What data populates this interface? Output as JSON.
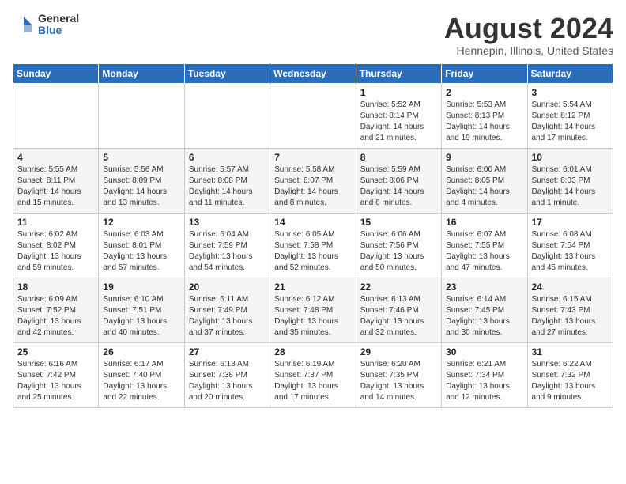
{
  "header": {
    "logo_general": "General",
    "logo_blue": "Blue",
    "month": "August 2024",
    "location": "Hennepin, Illinois, United States"
  },
  "weekdays": [
    "Sunday",
    "Monday",
    "Tuesday",
    "Wednesday",
    "Thursday",
    "Friday",
    "Saturday"
  ],
  "weeks": [
    [
      {
        "day": "",
        "info": ""
      },
      {
        "day": "",
        "info": ""
      },
      {
        "day": "",
        "info": ""
      },
      {
        "day": "",
        "info": ""
      },
      {
        "day": "1",
        "info": "Sunrise: 5:52 AM\nSunset: 8:14 PM\nDaylight: 14 hours\nand 21 minutes."
      },
      {
        "day": "2",
        "info": "Sunrise: 5:53 AM\nSunset: 8:13 PM\nDaylight: 14 hours\nand 19 minutes."
      },
      {
        "day": "3",
        "info": "Sunrise: 5:54 AM\nSunset: 8:12 PM\nDaylight: 14 hours\nand 17 minutes."
      }
    ],
    [
      {
        "day": "4",
        "info": "Sunrise: 5:55 AM\nSunset: 8:11 PM\nDaylight: 14 hours\nand 15 minutes."
      },
      {
        "day": "5",
        "info": "Sunrise: 5:56 AM\nSunset: 8:09 PM\nDaylight: 14 hours\nand 13 minutes."
      },
      {
        "day": "6",
        "info": "Sunrise: 5:57 AM\nSunset: 8:08 PM\nDaylight: 14 hours\nand 11 minutes."
      },
      {
        "day": "7",
        "info": "Sunrise: 5:58 AM\nSunset: 8:07 PM\nDaylight: 14 hours\nand 8 minutes."
      },
      {
        "day": "8",
        "info": "Sunrise: 5:59 AM\nSunset: 8:06 PM\nDaylight: 14 hours\nand 6 minutes."
      },
      {
        "day": "9",
        "info": "Sunrise: 6:00 AM\nSunset: 8:05 PM\nDaylight: 14 hours\nand 4 minutes."
      },
      {
        "day": "10",
        "info": "Sunrise: 6:01 AM\nSunset: 8:03 PM\nDaylight: 14 hours\nand 1 minute."
      }
    ],
    [
      {
        "day": "11",
        "info": "Sunrise: 6:02 AM\nSunset: 8:02 PM\nDaylight: 13 hours\nand 59 minutes."
      },
      {
        "day": "12",
        "info": "Sunrise: 6:03 AM\nSunset: 8:01 PM\nDaylight: 13 hours\nand 57 minutes."
      },
      {
        "day": "13",
        "info": "Sunrise: 6:04 AM\nSunset: 7:59 PM\nDaylight: 13 hours\nand 54 minutes."
      },
      {
        "day": "14",
        "info": "Sunrise: 6:05 AM\nSunset: 7:58 PM\nDaylight: 13 hours\nand 52 minutes."
      },
      {
        "day": "15",
        "info": "Sunrise: 6:06 AM\nSunset: 7:56 PM\nDaylight: 13 hours\nand 50 minutes."
      },
      {
        "day": "16",
        "info": "Sunrise: 6:07 AM\nSunset: 7:55 PM\nDaylight: 13 hours\nand 47 minutes."
      },
      {
        "day": "17",
        "info": "Sunrise: 6:08 AM\nSunset: 7:54 PM\nDaylight: 13 hours\nand 45 minutes."
      }
    ],
    [
      {
        "day": "18",
        "info": "Sunrise: 6:09 AM\nSunset: 7:52 PM\nDaylight: 13 hours\nand 42 minutes."
      },
      {
        "day": "19",
        "info": "Sunrise: 6:10 AM\nSunset: 7:51 PM\nDaylight: 13 hours\nand 40 minutes."
      },
      {
        "day": "20",
        "info": "Sunrise: 6:11 AM\nSunset: 7:49 PM\nDaylight: 13 hours\nand 37 minutes."
      },
      {
        "day": "21",
        "info": "Sunrise: 6:12 AM\nSunset: 7:48 PM\nDaylight: 13 hours\nand 35 minutes."
      },
      {
        "day": "22",
        "info": "Sunrise: 6:13 AM\nSunset: 7:46 PM\nDaylight: 13 hours\nand 32 minutes."
      },
      {
        "day": "23",
        "info": "Sunrise: 6:14 AM\nSunset: 7:45 PM\nDaylight: 13 hours\nand 30 minutes."
      },
      {
        "day": "24",
        "info": "Sunrise: 6:15 AM\nSunset: 7:43 PM\nDaylight: 13 hours\nand 27 minutes."
      }
    ],
    [
      {
        "day": "25",
        "info": "Sunrise: 6:16 AM\nSunset: 7:42 PM\nDaylight: 13 hours\nand 25 minutes."
      },
      {
        "day": "26",
        "info": "Sunrise: 6:17 AM\nSunset: 7:40 PM\nDaylight: 13 hours\nand 22 minutes."
      },
      {
        "day": "27",
        "info": "Sunrise: 6:18 AM\nSunset: 7:38 PM\nDaylight: 13 hours\nand 20 minutes."
      },
      {
        "day": "28",
        "info": "Sunrise: 6:19 AM\nSunset: 7:37 PM\nDaylight: 13 hours\nand 17 minutes."
      },
      {
        "day": "29",
        "info": "Sunrise: 6:20 AM\nSunset: 7:35 PM\nDaylight: 13 hours\nand 14 minutes."
      },
      {
        "day": "30",
        "info": "Sunrise: 6:21 AM\nSunset: 7:34 PM\nDaylight: 13 hours\nand 12 minutes."
      },
      {
        "day": "31",
        "info": "Sunrise: 6:22 AM\nSunset: 7:32 PM\nDaylight: 13 hours\nand 9 minutes."
      }
    ]
  ]
}
